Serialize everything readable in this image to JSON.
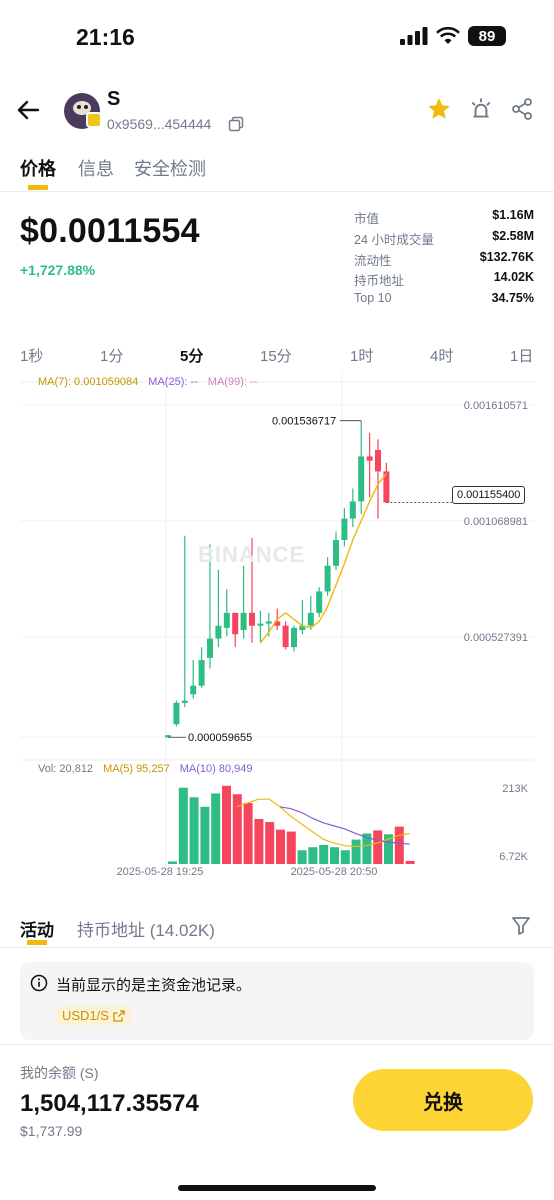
{
  "status_bar": {
    "time": "21:16",
    "battery": "89"
  },
  "header": {
    "symbol": "S",
    "address": "0x9569...454444"
  },
  "tabs": [
    "价格",
    "信息",
    "安全检测"
  ],
  "price": {
    "value": "$0.0011554",
    "change": "+1,727.88%"
  },
  "stats": [
    {
      "label": "市值",
      "value": "$1.16M"
    },
    {
      "label": "24 小时成交量",
      "value": "$2.58M"
    },
    {
      "label": "流动性",
      "value": "$132.76K"
    },
    {
      "label": "持币地址",
      "value": "14.02K"
    },
    {
      "label": "Top 10",
      "value": "34.75%"
    }
  ],
  "intervals": [
    "1秒",
    "1分",
    "5分",
    "15分",
    "1时",
    "4时",
    "1日"
  ],
  "active_interval": "5分",
  "chart": {
    "ma7": "MA(7): 0.001059084",
    "ma25": "MA(25): --",
    "ma99": "MA(99): --",
    "vol": "Vol: 20,812",
    "vol_ma5": "MA(5) 95,257",
    "vol_ma10": "MA(10) 80,949",
    "watermark": "BINANCE",
    "current_price": "0.001155400",
    "colors": {
      "up": "#2ebd85",
      "down": "#f6465d",
      "ma7": "#f0b90b",
      "ma25": "#8a5bd6",
      "ma99": "#d67fb6"
    }
  },
  "chart_data": {
    "type": "candlestick",
    "price_axis_labels": [
      "0.001610571",
      "0.001068981",
      "0.000527391"
    ],
    "volume_axis_labels": [
      "213K",
      "6.72K"
    ],
    "x_tick_labels": [
      "2025-05-28 19:25",
      "2025-05-28 20:50"
    ],
    "high_label": "0.001536717",
    "low_label": "0.000059655",
    "candles": [
      {
        "o": 5.9e-05,
        "h": 7e-05,
        "l": 5.8e-05,
        "c": 6.9e-05
      },
      {
        "o": 0.00012,
        "h": 0.00023,
        "l": 0.00011,
        "c": 0.00022
      },
      {
        "o": 0.00022,
        "h": 0.001,
        "l": 0.0002,
        "c": 0.00023
      },
      {
        "o": 0.00026,
        "h": 0.00042,
        "l": 0.00024,
        "c": 0.0003
      },
      {
        "o": 0.0003,
        "h": 0.00048,
        "l": 0.00029,
        "c": 0.00042
      },
      {
        "o": 0.00043,
        "h": 0.00096,
        "l": 0.00038,
        "c": 0.00052
      },
      {
        "o": 0.00052,
        "h": 0.00084,
        "l": 0.00048,
        "c": 0.00058
      },
      {
        "o": 0.00057,
        "h": 0.00075,
        "l": 0.00053,
        "c": 0.00064
      },
      {
        "o": 0.00064,
        "h": 0.00054,
        "l": 0.00048,
        "c": 0.00054
      },
      {
        "o": 0.00056,
        "h": 0.00086,
        "l": 0.00052,
        "c": 0.00064
      },
      {
        "o": 0.00064,
        "h": 0.00099,
        "l": 0.0005,
        "c": 0.00058
      },
      {
        "o": 0.00058,
        "h": 0.00065,
        "l": 0.0005,
        "c": 0.00059
      },
      {
        "o": 0.00059,
        "h": 0.00064,
        "l": 0.00053,
        "c": 0.0006
      },
      {
        "o": 0.0006,
        "h": 0.00066,
        "l": 0.00056,
        "c": 0.00058
      },
      {
        "o": 0.00058,
        "h": 0.0006,
        "l": 0.00047,
        "c": 0.00048
      },
      {
        "o": 0.00048,
        "h": 0.00058,
        "l": 0.00046,
        "c": 0.00057
      },
      {
        "o": 0.00056,
        "h": 0.0007,
        "l": 0.00054,
        "c": 0.00058
      },
      {
        "o": 0.00058,
        "h": 0.00072,
        "l": 0.00056,
        "c": 0.00064
      },
      {
        "o": 0.00064,
        "h": 0.00076,
        "l": 0.00062,
        "c": 0.00074
      },
      {
        "o": 0.00074,
        "h": 0.0009,
        "l": 0.00072,
        "c": 0.00086
      },
      {
        "o": 0.00086,
        "h": 0.00102,
        "l": 0.00084,
        "c": 0.00098
      },
      {
        "o": 0.00098,
        "h": 0.00113,
        "l": 0.00095,
        "c": 0.00108
      },
      {
        "o": 0.00108,
        "h": 0.00122,
        "l": 0.00104,
        "c": 0.00116
      },
      {
        "o": 0.00116,
        "h": 0.001536,
        "l": 0.0011,
        "c": 0.00137
      },
      {
        "o": 0.00137,
        "h": 0.00148,
        "l": 0.00118,
        "c": 0.00135
      },
      {
        "o": 0.0014,
        "h": 0.00145,
        "l": 0.00108,
        "c": 0.0013
      },
      {
        "o": 0.0013,
        "h": 0.00134,
        "l": 0.00117,
        "c": 0.001155
      }
    ],
    "ma7_line": [
      0.0005,
      0.00055,
      0.00061,
      0.00064,
      0.00061,
      0.00058,
      0.00057,
      0.0006,
      0.00067,
      0.00077,
      0.00087,
      0.00098,
      0.00107,
      0.00116,
      0.00124,
      0.00129
    ],
    "volumes": [
      6.7,
      200,
      175,
      150,
      185,
      205,
      183,
      160,
      118,
      110,
      90,
      85,
      36,
      44,
      50,
      44,
      36,
      64,
      80,
      88,
      78,
      98,
      8
    ],
    "vol_ma5": [
      150,
      160,
      170,
      170,
      150,
      125,
      105,
      85,
      65,
      55,
      48,
      46,
      48,
      55,
      65,
      75,
      80
    ],
    "vol_ma10": [
      150,
      145,
      135,
      120,
      108,
      100,
      92,
      80,
      70,
      62,
      57,
      55,
      52
    ]
  },
  "activity": {
    "tabs": [
      "活动",
      "持币地址 (14.02K)"
    ],
    "notice": "当前显示的是主资金池记录。",
    "pool_link": "USD1/S"
  },
  "balance": {
    "label": "我的余额 (S)",
    "value": "1,504,117.35574",
    "fiat": "$1,737.99",
    "button": "兑换"
  }
}
